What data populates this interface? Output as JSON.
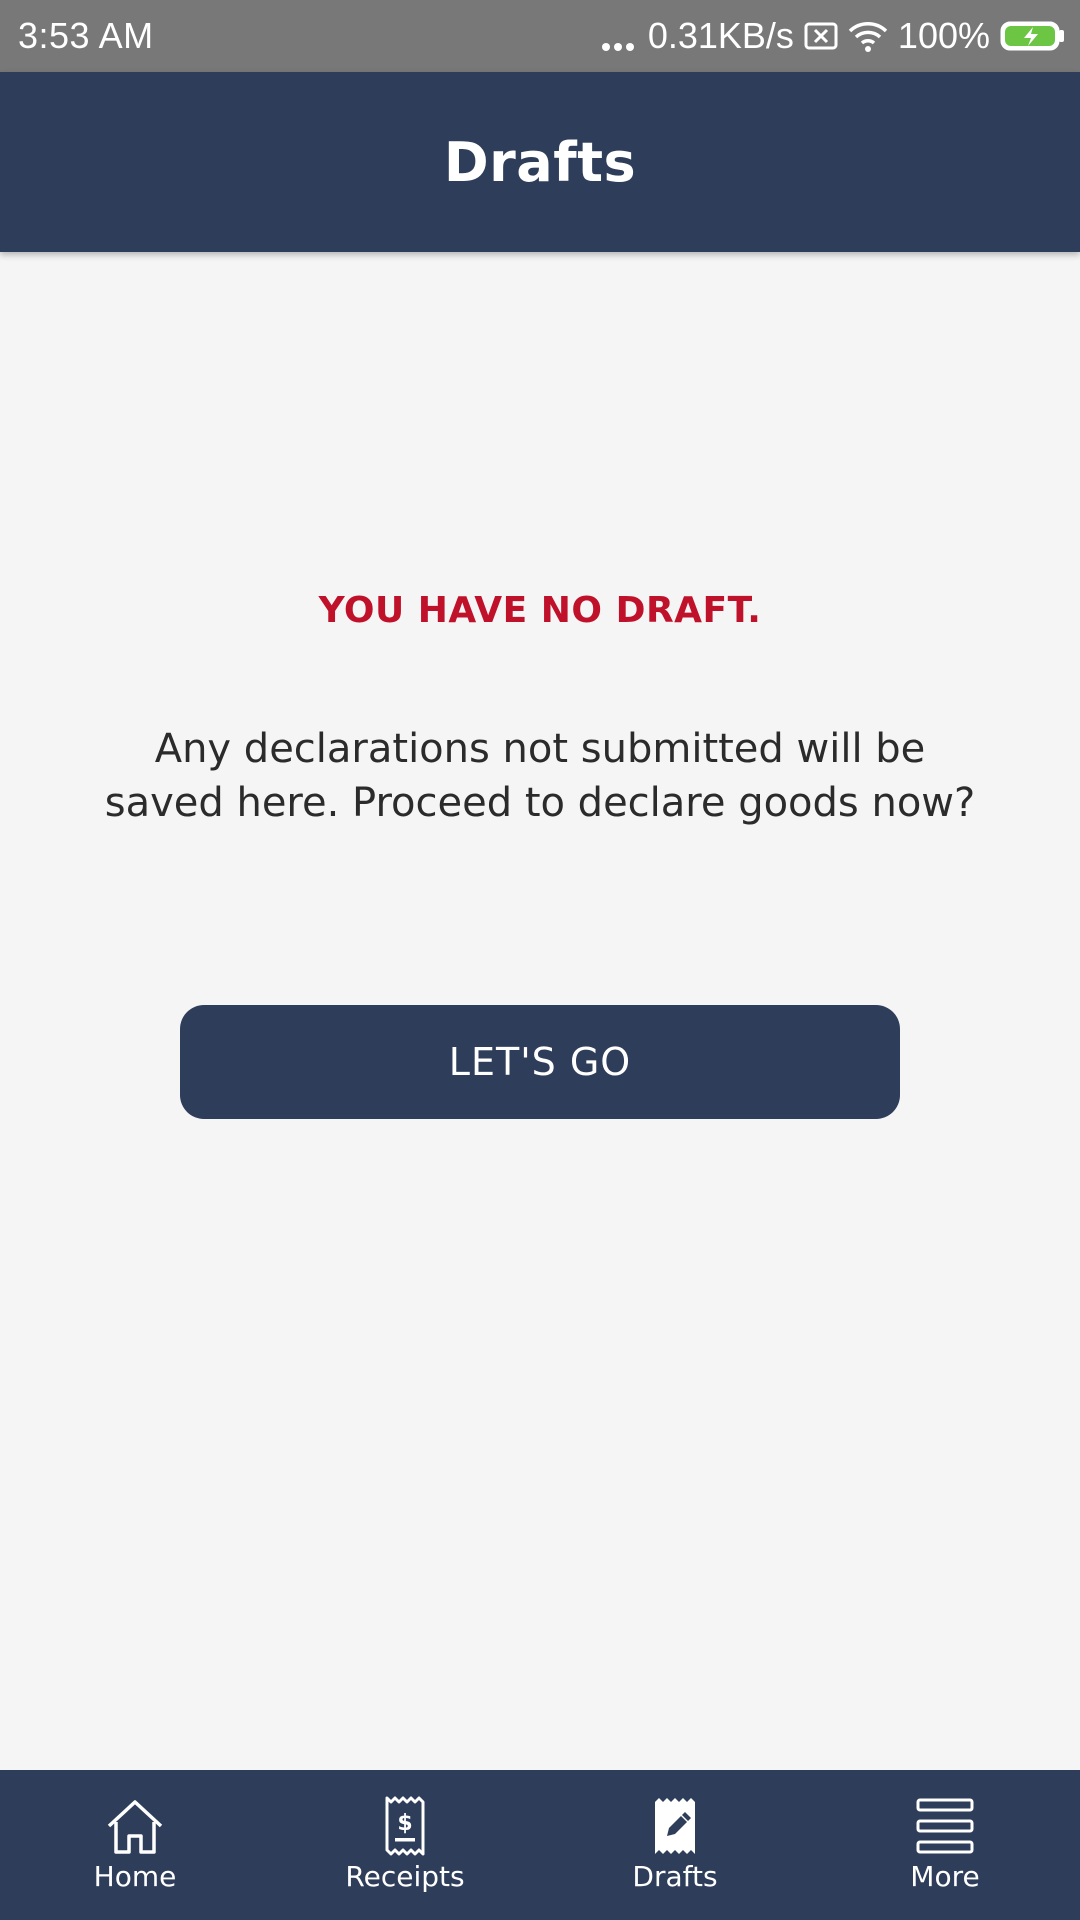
{
  "status_bar": {
    "time": "3:53  AM",
    "network_speed": "0.31KB/s",
    "battery": "100%",
    "icons": [
      "more-dots-icon",
      "sim-error-icon",
      "wifi-icon",
      "battery-charging-icon"
    ]
  },
  "header": {
    "title": "Drafts",
    "background_color": "#2e3d5a"
  },
  "empty_state": {
    "title": "YOU HAVE NO DRAFT.",
    "title_color": "#c0112b",
    "description": "Any declarations not submitted will be saved here. Proceed to declare goods now?",
    "button_label": "LET'S GO"
  },
  "bottom_nav": {
    "items": [
      {
        "label": "Home",
        "icon": "home-icon",
        "active": false
      },
      {
        "label": "Receipts",
        "icon": "receipt-icon",
        "active": false
      },
      {
        "label": "Drafts",
        "icon": "draft-icon",
        "active": true
      },
      {
        "label": "More",
        "icon": "menu-icon",
        "active": false
      }
    ]
  }
}
